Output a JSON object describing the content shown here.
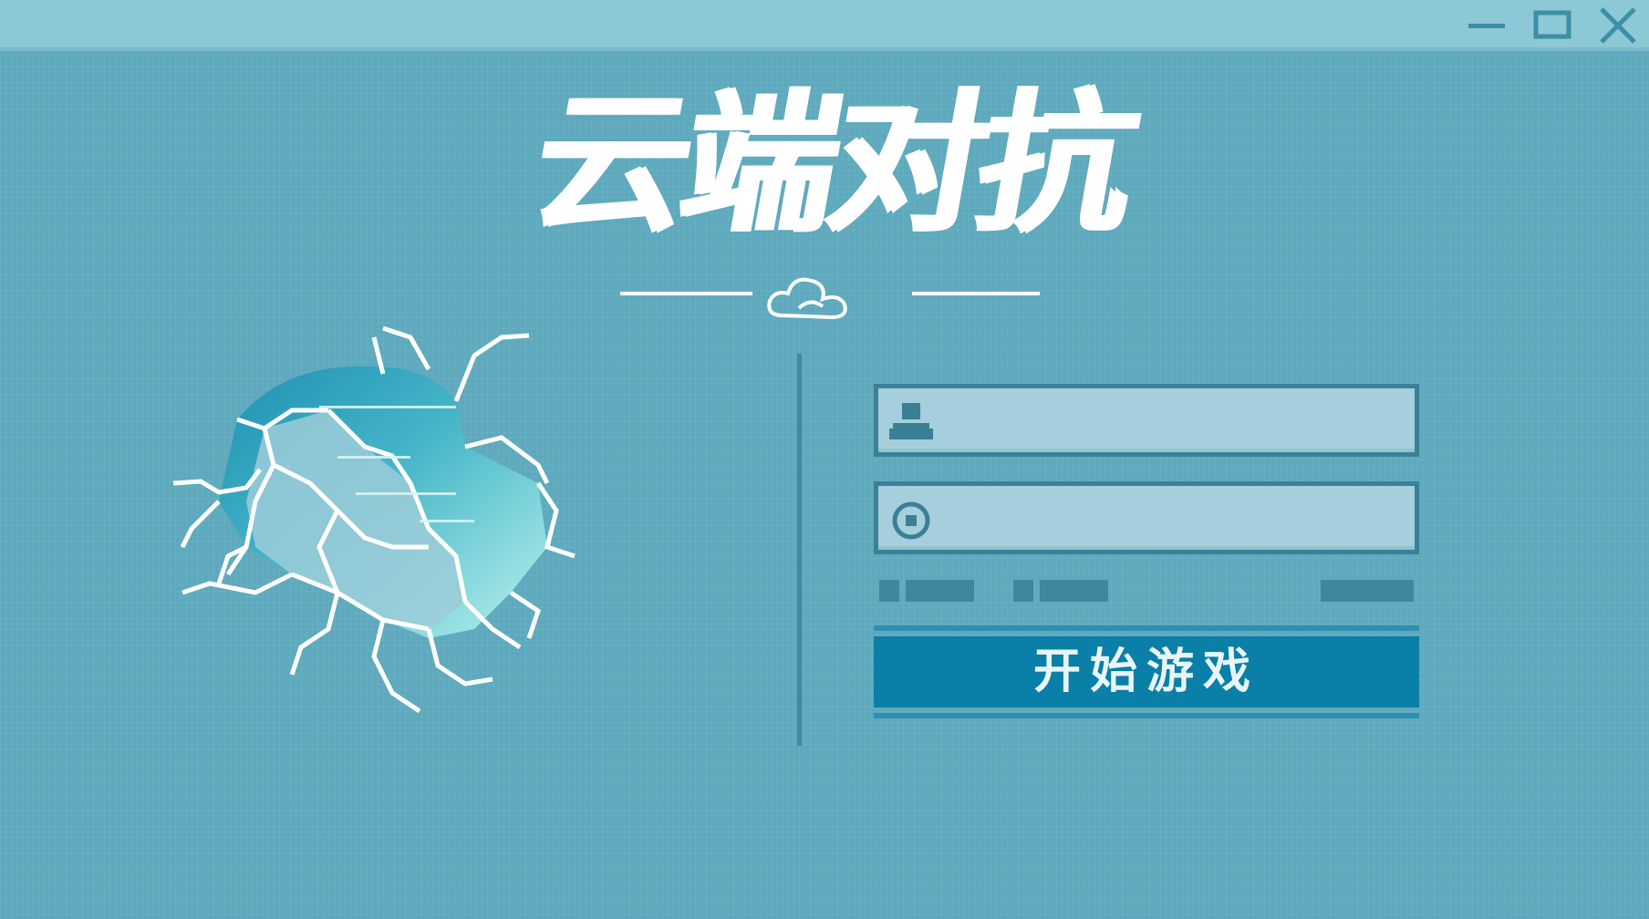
{
  "window": {
    "controls": {
      "minimize_icon": "minimize-icon",
      "maximize_icon": "maximize-icon",
      "close_icon": "close-icon"
    }
  },
  "logo": {
    "title": "云端对抗",
    "decoration_icon": "cloud-icon"
  },
  "login": {
    "username": {
      "icon": "user-icon",
      "value": "",
      "placeholder": ""
    },
    "password": {
      "icon": "lock-icon",
      "value": "",
      "placeholder": ""
    },
    "start_label": "开始游戏"
  },
  "illustration": {
    "icon": "cracked-sky-icon"
  },
  "colors": {
    "background": "#5ea9bd",
    "titlebar": "#8cc8d6",
    "field_fill": "#a5cfdc",
    "field_border": "#3a8198",
    "button": "#0a7fa8",
    "text_white": "#ffffff"
  }
}
